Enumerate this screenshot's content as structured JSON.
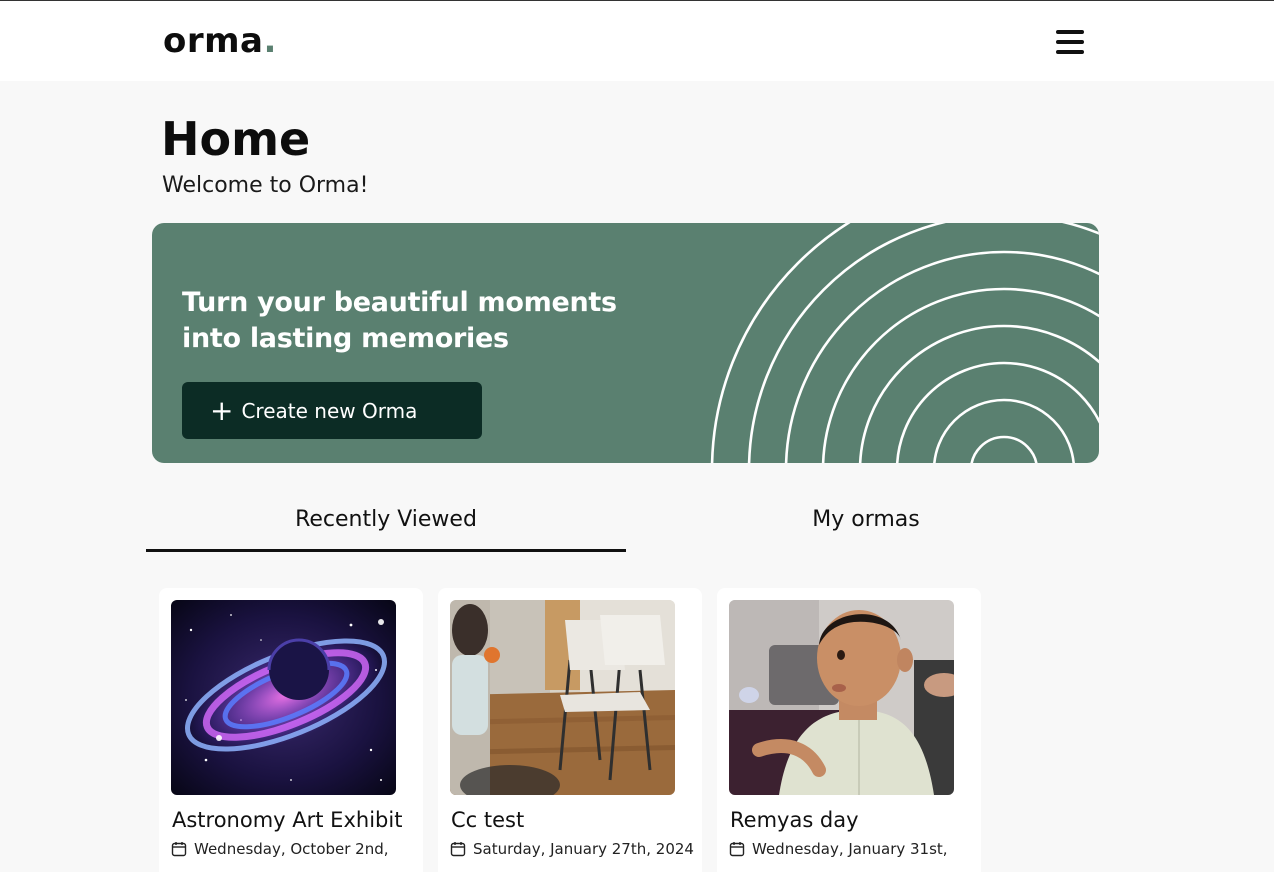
{
  "header": {
    "logo_text": "orma",
    "logo_dot": ".",
    "menu_icon": "hamburger-icon"
  },
  "page": {
    "title": "Home",
    "subtitle": "Welcome to Orma!"
  },
  "hero": {
    "headline": "Turn your beautiful moments into lasting memories",
    "button_icon": "plus-icon",
    "button_plus": "+",
    "button_label": "Create new Orma",
    "background_color": "#5a8070",
    "button_color": "#0c2c25"
  },
  "tabs": [
    {
      "label": "Recently Viewed",
      "active": true
    },
    {
      "label": "My ormas",
      "active": false
    }
  ],
  "cards": [
    {
      "title": "Astronomy Art Exhibit",
      "date": "Wednesday, October 2nd,",
      "icon": "calendar-icon",
      "image": "galaxy-planet"
    },
    {
      "title": "Cc test",
      "date": "Saturday, January 27th, 2024",
      "icon": "calendar-icon",
      "image": "child-room"
    },
    {
      "title": "Remyas day",
      "date": "Wednesday, January 31st,",
      "icon": "calendar-icon",
      "image": "baby-portrait"
    }
  ]
}
